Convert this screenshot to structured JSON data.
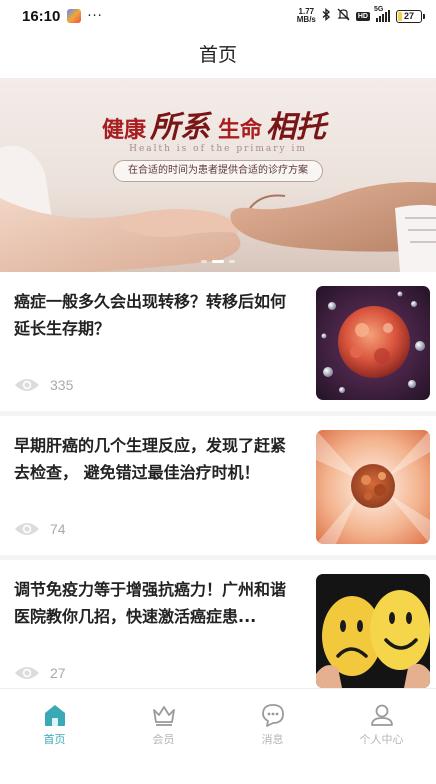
{
  "status_bar": {
    "time": "16:10",
    "more": "···",
    "net_speed_value": "1.77",
    "net_speed_unit": "MB/s",
    "signal_label": "5G",
    "battery": "27",
    "battery_level": 0.27,
    "battery_color": "#f4d34a"
  },
  "header": {
    "title": "首页"
  },
  "banner": {
    "headline_a": "健康",
    "headline_b": "所系",
    "headline_c": "生命",
    "headline_d": "相托",
    "subtitle": "Health is of the primary im",
    "tagline": "在合适的时间为患者提供合适的诊疗方案",
    "slide_count": 3,
    "active_slide": 2
  },
  "articles": [
    {
      "title": "癌症一般多久会出现转移？转移后如何延长生存期？",
      "views": "335",
      "thumb": "cancer-cell-image"
    },
    {
      "title": "早期肝癌的几个生理反应，发现了赶紧去检查， 避免错过最佳治疗时机！",
      "views": "74",
      "thumb": "tumor-cell-image"
    },
    {
      "title": "调节免疫力等于增强抗癌力！广州和谐医院教你几招，快速激活癌症患...",
      "views": "27",
      "thumb": "sad-happy-faces-image"
    }
  ],
  "tab_bar": {
    "items": [
      {
        "label": "首页",
        "icon": "home-icon",
        "active": true
      },
      {
        "label": "会员",
        "icon": "crown-icon",
        "active": false
      },
      {
        "label": "消息",
        "icon": "chat-bubble-icon",
        "active": false
      },
      {
        "label": "个人中心",
        "icon": "user-icon",
        "active": false
      }
    ]
  },
  "colors": {
    "accent": "#3aa9b5",
    "headline_red": "#a81d20",
    "inactive": "#b5b5b5"
  }
}
